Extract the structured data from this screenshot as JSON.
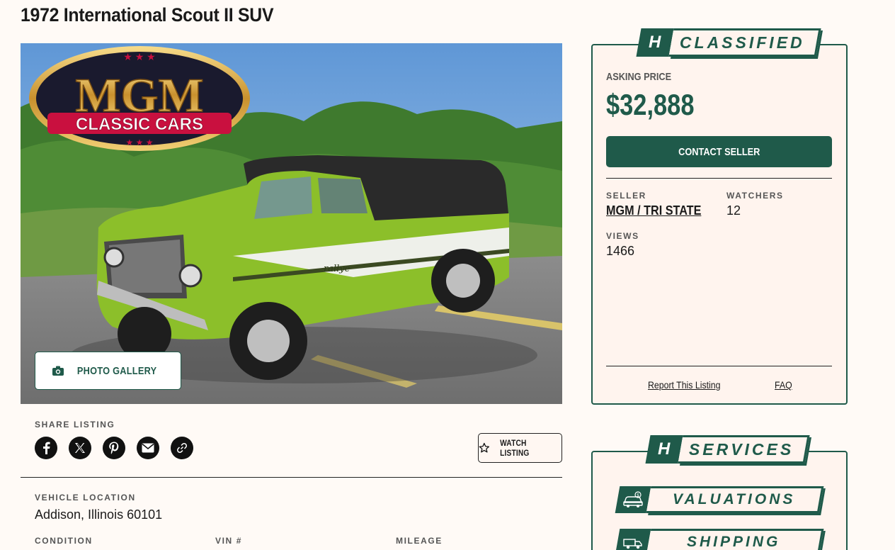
{
  "listing": {
    "title": "1972 International Scout II SUV",
    "gallery_button": "PHOTO GALLERY",
    "logo_text_line1": "MGM",
    "logo_text_line2": "CLASSIC CARS",
    "car_badge": "rallye"
  },
  "share": {
    "label": "SHARE LISTING",
    "icons": [
      "facebook-icon",
      "x-icon",
      "pinterest-icon",
      "email-icon",
      "link-icon"
    ]
  },
  "watch": {
    "label": "WATCH LISTING"
  },
  "details": {
    "location_label": "VEHICLE LOCATION",
    "location_value": "Addison, Illinois 60101",
    "condition_label": "CONDITION",
    "vin_label": "VIN #",
    "mileage_label": "MILEAGE"
  },
  "classified": {
    "badge_letter": "H",
    "badge_text": "CLASSIFIED",
    "asking_label": "ASKING PRICE",
    "price": "$32,888",
    "contact_button": "CONTACT SELLER",
    "seller_label": "SELLER",
    "seller_value": "MGM / TRI STATE",
    "watchers_label": "WATCHERS",
    "watchers_value": "12",
    "views_label": "VIEWS",
    "views_value": "1466",
    "report_link": "Report This Listing",
    "faq_link": "FAQ"
  },
  "services": {
    "badge_letter": "H",
    "badge_text": "SERVICES",
    "items": [
      {
        "label": "VALUATIONS",
        "icon": "car-dollar-icon"
      },
      {
        "label": "SHIPPING",
        "icon": "truck-icon"
      }
    ]
  },
  "colors": {
    "brand_green": "#1f5a4a",
    "page_bg": "#fffaf6",
    "card_bg": "#fff4ee",
    "car_green": "#8cbf2a"
  }
}
